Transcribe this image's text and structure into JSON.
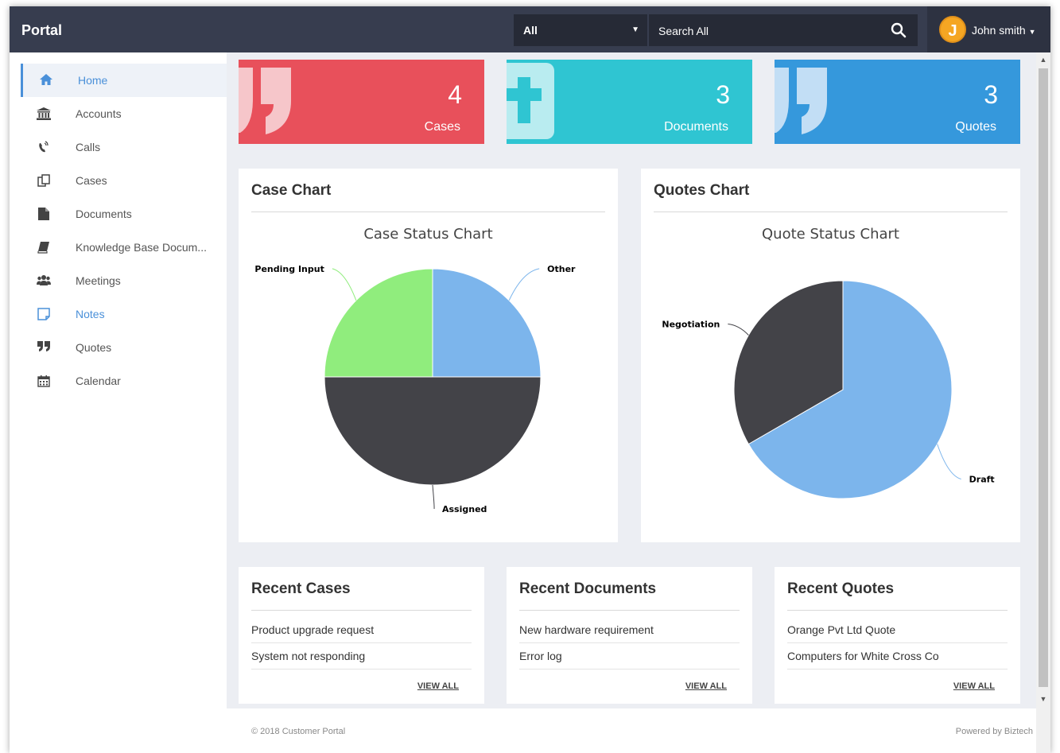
{
  "app": {
    "title": "Portal"
  },
  "search": {
    "scope": "All",
    "placeholder": "Search All"
  },
  "user": {
    "initial": "J",
    "name": "John smith"
  },
  "sidebar": {
    "items": [
      {
        "label": "Home",
        "icon": "home-icon"
      },
      {
        "label": "Accounts",
        "icon": "bank-icon"
      },
      {
        "label": "Calls",
        "icon": "phone-icon"
      },
      {
        "label": "Cases",
        "icon": "cases-icon"
      },
      {
        "label": "Documents",
        "icon": "document-icon"
      },
      {
        "label": "Knowledge Base Docum...",
        "icon": "book-icon"
      },
      {
        "label": "Meetings",
        "icon": "users-icon"
      },
      {
        "label": "Notes",
        "icon": "note-icon"
      },
      {
        "label": "Quotes",
        "icon": "quote-icon"
      },
      {
        "label": "Calendar",
        "icon": "calendar-icon"
      }
    ]
  },
  "stats": [
    {
      "count": "4",
      "label": "Cases",
      "color": "#e8505b"
    },
    {
      "count": "3",
      "label": "Documents",
      "color": "#2fc5d2"
    },
    {
      "count": "3",
      "label": "Quotes",
      "color": "#3598dc"
    }
  ],
  "case_chart": {
    "card_title": "Case Chart"
  },
  "quotes_chart": {
    "card_title": "Quotes Chart"
  },
  "chart_data": [
    {
      "type": "pie",
      "title": "Case Status Chart",
      "categories": [
        "Other",
        "Assigned",
        "Pending Input"
      ],
      "values": [
        1,
        2,
        1
      ],
      "colors": [
        "#7cb5ec",
        "#434348",
        "#90ed7d"
      ]
    },
    {
      "type": "pie",
      "title": "Quote Status Chart",
      "categories": [
        "Draft",
        "Negotiation"
      ],
      "values": [
        2,
        1
      ],
      "colors": [
        "#7cb5ec",
        "#434348"
      ]
    }
  ],
  "recent": {
    "cases": {
      "title": "Recent Cases",
      "items": [
        "Product upgrade request",
        "System not responding"
      ],
      "view_all": "VIEW ALL"
    },
    "documents": {
      "title": "Recent Documents",
      "items": [
        "New hardware requirement",
        "Error log"
      ],
      "view_all": "VIEW ALL"
    },
    "quotes": {
      "title": "Recent Quotes",
      "items": [
        "Orange Pvt Ltd Quote",
        "Computers for White Cross Co"
      ],
      "view_all": "VIEW ALL"
    }
  },
  "footer": {
    "copyright": "© 2018 Customer Portal",
    "powered": "Powered by Biztech"
  }
}
